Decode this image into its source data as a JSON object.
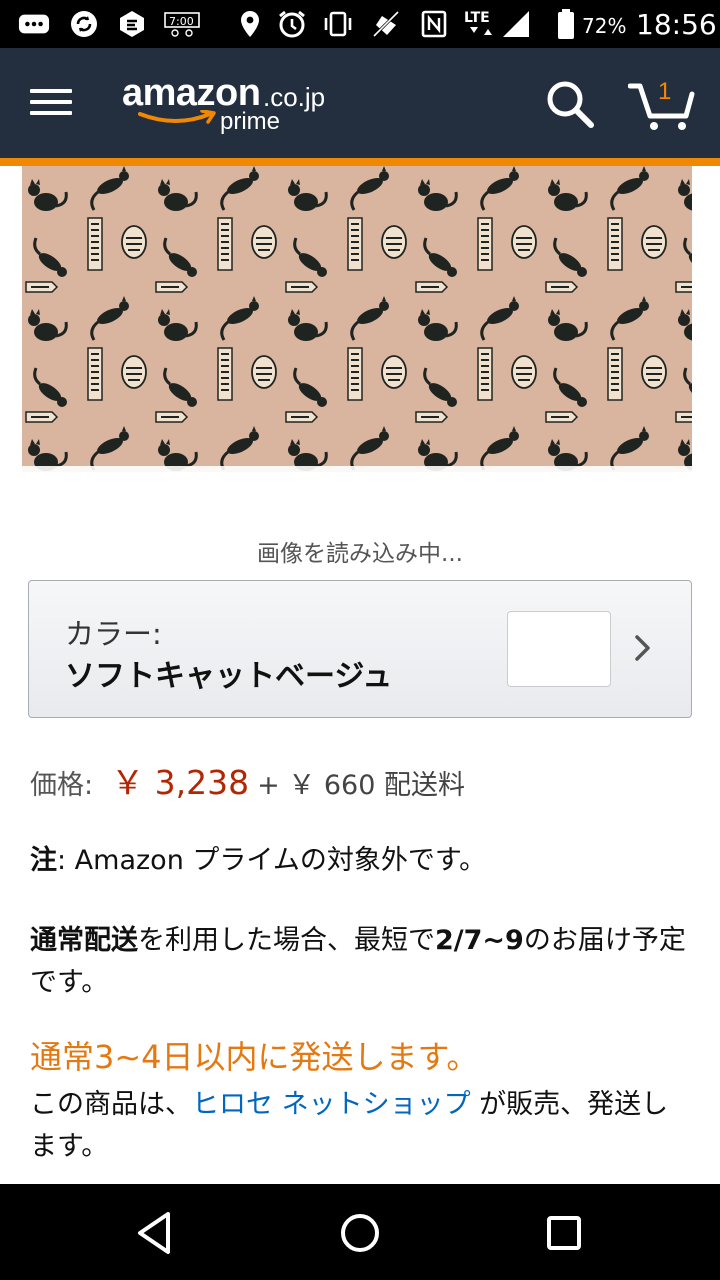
{
  "status_bar": {
    "battery_percent": "72%",
    "time": "18:56",
    "network": "LTE",
    "icons": [
      "message-icon",
      "sync-icon",
      "app-icon",
      "clock-widget-icon",
      "location-icon",
      "alarm-icon",
      "vibrate-icon",
      "mute-icon",
      "nfc-icon",
      "lte-icon",
      "signal-icon",
      "battery-icon"
    ]
  },
  "header": {
    "logo_main": "amazon",
    "logo_tld": ".co.jp",
    "logo_sub": "prime",
    "cart_count": "1",
    "colors": {
      "background": "#232f3e",
      "accent": "#f08804"
    }
  },
  "product": {
    "image_alt": "",
    "loading_text": "画像を読み込み中..."
  },
  "color_selector": {
    "label": "カラー:",
    "value": "ソフトキャットベージュ"
  },
  "price": {
    "label": "価格:",
    "value": "￥ 3,238",
    "shipping": "+ ￥ 660 配送料",
    "color": "#b12704"
  },
  "note": {
    "prefix": "注",
    "text": ": Amazon プライムの対象外です。"
  },
  "delivery": {
    "method": "通常配送",
    "mid": "を利用した場合、最短で",
    "date": "2/7~9",
    "suffix": "のお届け予定です。"
  },
  "dispatch": {
    "text": "通常3~4日以内に発送します。",
    "color": "#e47911"
  },
  "seller": {
    "prefix": "この商品は、",
    "link": "ヒロセ ネットショップ",
    "suffix": " が販売、発送します。"
  },
  "nav": {
    "icons": [
      "back-icon",
      "home-icon",
      "recents-icon"
    ]
  }
}
